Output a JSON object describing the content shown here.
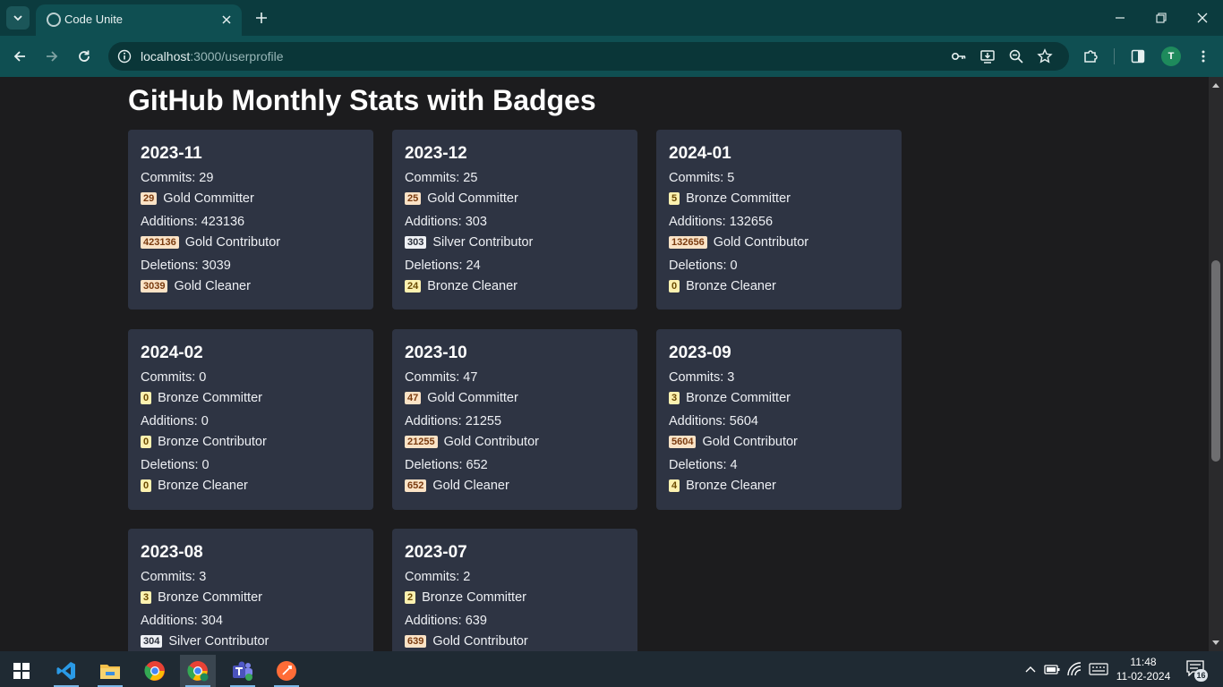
{
  "browser": {
    "tab_title": "Code Unite",
    "url_host": "localhost",
    "url_path": ":3000/userprofile",
    "profile_initial": "T"
  },
  "page": {
    "title": "GitHub Monthly Stats with Badges"
  },
  "cards": [
    {
      "month": "2023-11",
      "commits": "Commits: 29",
      "commits_val": "29",
      "commits_badge": "Gold Committer",
      "commits_level": "Gold",
      "additions": "Additions: 423136",
      "additions_val": "423136",
      "additions_badge": "Gold Contributor",
      "additions_level": "Gold",
      "deletions": "Deletions: 3039",
      "deletions_val": "3039",
      "deletions_badge": "Gold Cleaner",
      "deletions_level": "Gold"
    },
    {
      "month": "2023-12",
      "commits": "Commits: 25",
      "commits_val": "25",
      "commits_badge": "Gold Committer",
      "commits_level": "Gold",
      "additions": "Additions: 303",
      "additions_val": "303",
      "additions_badge": "Silver Contributor",
      "additions_level": "Silver",
      "deletions": "Deletions: 24",
      "deletions_val": "24",
      "deletions_badge": "Bronze Cleaner",
      "deletions_level": "Bronze"
    },
    {
      "month": "2024-01",
      "commits": "Commits: 5",
      "commits_val": "5",
      "commits_badge": "Bronze Committer",
      "commits_level": "Bronze",
      "additions": "Additions: 132656",
      "additions_val": "132656",
      "additions_badge": "Gold Contributor",
      "additions_level": "Gold",
      "deletions": "Deletions: 0",
      "deletions_val": "0",
      "deletions_badge": "Bronze Cleaner",
      "deletions_level": "Bronze"
    },
    {
      "month": "2024-02",
      "commits": "Commits: 0",
      "commits_val": "0",
      "commits_badge": "Bronze Committer",
      "commits_level": "Bronze",
      "additions": "Additions: 0",
      "additions_val": "0",
      "additions_badge": "Bronze Contributor",
      "additions_level": "Bronze",
      "deletions": "Deletions: 0",
      "deletions_val": "0",
      "deletions_badge": "Bronze Cleaner",
      "deletions_level": "Bronze"
    },
    {
      "month": "2023-10",
      "commits": "Commits: 47",
      "commits_val": "47",
      "commits_badge": "Gold Committer",
      "commits_level": "Gold",
      "additions": "Additions: 21255",
      "additions_val": "21255",
      "additions_badge": "Gold Contributor",
      "additions_level": "Gold",
      "deletions": "Deletions: 652",
      "deletions_val": "652",
      "deletions_badge": "Gold Cleaner",
      "deletions_level": "Gold"
    },
    {
      "month": "2023-09",
      "commits": "Commits: 3",
      "commits_val": "3",
      "commits_badge": "Bronze Committer",
      "commits_level": "Bronze",
      "additions": "Additions: 5604",
      "additions_val": "5604",
      "additions_badge": "Gold Contributor",
      "additions_level": "Gold",
      "deletions": "Deletions: 4",
      "deletions_val": "4",
      "deletions_badge": "Bronze Cleaner",
      "deletions_level": "Bronze"
    },
    {
      "month": "2023-08",
      "commits": "Commits: 3",
      "commits_val": "3",
      "commits_badge": "Bronze Committer",
      "commits_level": "Bronze",
      "additions": "Additions: 304",
      "additions_val": "304",
      "additions_badge": "Silver Contributor",
      "additions_level": "Silver",
      "deletions": "",
      "deletions_val": "",
      "deletions_badge": "",
      "deletions_level": ""
    },
    {
      "month": "2023-07",
      "commits": "Commits: 2",
      "commits_val": "2",
      "commits_badge": "Bronze Committer",
      "commits_level": "Bronze",
      "additions": "Additions: 639",
      "additions_val": "639",
      "additions_badge": "Gold Contributor",
      "additions_level": "Gold",
      "deletions": "",
      "deletions_val": "",
      "deletions_badge": "",
      "deletions_level": ""
    }
  ],
  "taskbar": {
    "time": "11:48",
    "date": "11-02-2024",
    "notification_count": "16",
    "apps": [
      "windows-start",
      "vscode",
      "file-explorer",
      "chrome",
      "chrome-profile",
      "teams",
      "postman"
    ]
  },
  "colors": {
    "tab_strip": "#0b3b3e",
    "toolbar": "#0f4f52",
    "page_bg": "#1c1c1e",
    "card_bg": "#2e3443",
    "badge_gold": "#fbe3c6",
    "badge_silver": "#eef0f4",
    "badge_bronze": "#fcf1b0"
  }
}
